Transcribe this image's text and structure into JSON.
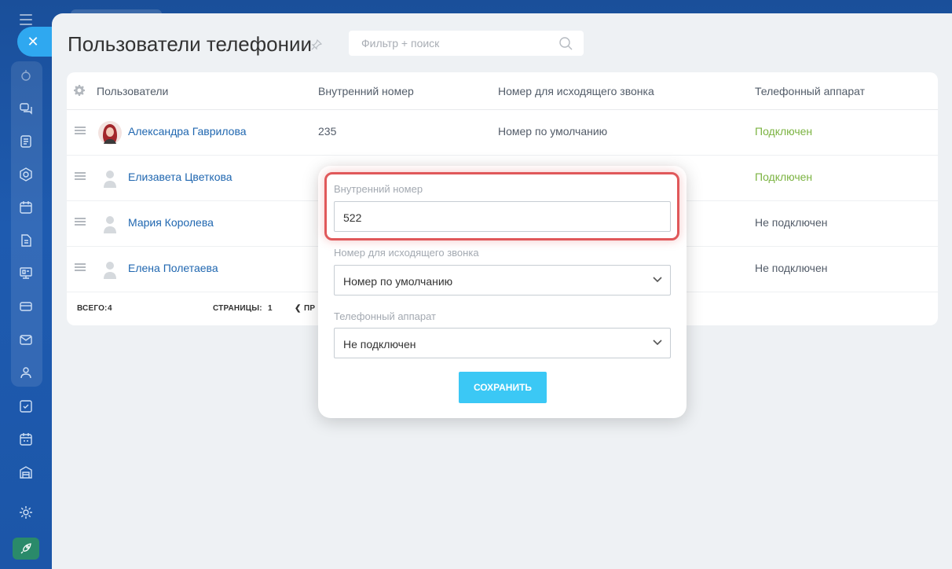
{
  "page": {
    "title": "Пользователи телефонии"
  },
  "search": {
    "placeholder": "Фильтр + поиск"
  },
  "table": {
    "columns": [
      "Пользователи",
      "Внутренний номер",
      "Номер для исходящего звонка",
      "Телефонный аппарат"
    ],
    "rows": [
      {
        "name": "Александра Гаврилова",
        "extension": "235",
        "outgoing": "Номер по умолчанию",
        "device": "Подключен",
        "connected": true
      },
      {
        "name": "Елизавета Цветкова",
        "extension": "",
        "outgoing": "",
        "device": "Подключен",
        "connected": true
      },
      {
        "name": "Мария Королева",
        "extension": "",
        "outgoing": "",
        "device": "Не подключен",
        "connected": false
      },
      {
        "name": "Елена Полетаева",
        "extension": "",
        "outgoing": "",
        "device": "Не подключен",
        "connected": false
      }
    ],
    "footer": {
      "total_label": "ВСЕГО:",
      "total_value": "4",
      "pages_label": "СТРАНИЦЫ:",
      "pages_value": "1",
      "prev_label": "ПР"
    }
  },
  "popup": {
    "extension_label": "Внутренний номер",
    "extension_value": "522",
    "outgoing_label": "Номер для исходящего звонка",
    "outgoing_value": "Номер по умолчанию",
    "device_label": "Телефонный аппарат",
    "device_value": "Не подключен",
    "save_label": "СОХРАНИТЬ"
  },
  "colors": {
    "accent": "#3bc8f5",
    "link": "#2067b0",
    "connected": "#7bb341",
    "highlight": "#e0585a"
  },
  "icons": [
    "menu-icon",
    "close-icon",
    "robot-icon",
    "chat-icon",
    "feed-icon",
    "shield-icon",
    "calendar-icon",
    "document-icon",
    "board-icon",
    "card-icon",
    "mail-icon",
    "people-icon",
    "task-icon",
    "schedule-icon",
    "store-icon",
    "gear-icon",
    "rocket-icon"
  ]
}
